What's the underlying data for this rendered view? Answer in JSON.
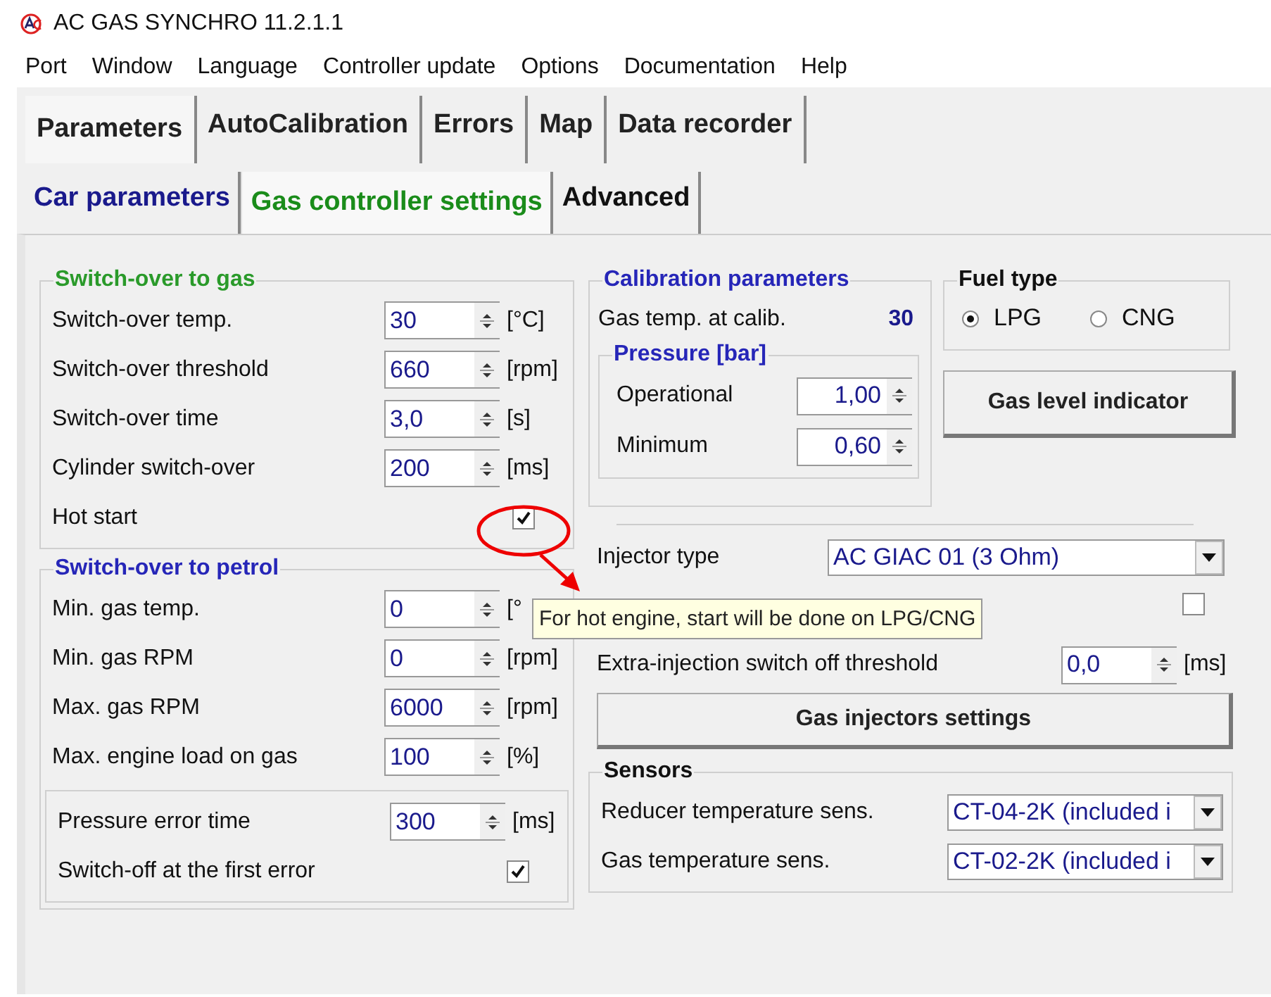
{
  "window": {
    "title": "AC GAS SYNCHRO  11.2.1.1"
  },
  "menu": [
    "Port",
    "Window",
    "Language",
    "Controller update",
    "Options",
    "Documentation",
    "Help"
  ],
  "tabs": [
    {
      "label": "Parameters",
      "selected": true
    },
    {
      "label": "AutoCalibration",
      "selected": false
    },
    {
      "label": "Errors",
      "selected": false
    },
    {
      "label": "Map",
      "selected": false
    },
    {
      "label": "Data recorder",
      "selected": false
    }
  ],
  "subtabs": [
    {
      "label": "Car parameters",
      "selected": false,
      "color": "#1a1a8c"
    },
    {
      "label": "Gas controller settings",
      "selected": true,
      "color": "#1a8c1a"
    },
    {
      "label": "Advanced",
      "selected": false,
      "color": "#111111"
    }
  ],
  "switch_to_gas": {
    "title": "Switch-over to gas",
    "rows": [
      {
        "kind": "spin",
        "label": "Switch-over temp.",
        "value": "30",
        "unit": "[°C]"
      },
      {
        "kind": "spin",
        "label": "Switch-over threshold",
        "value": "660",
        "unit": "[rpm]"
      },
      {
        "kind": "spin",
        "label": "Switch-over time",
        "value": "3,0",
        "unit": "[s]"
      },
      {
        "kind": "spin",
        "label": "Cylinder switch-over",
        "value": "200",
        "unit": "[ms]"
      },
      {
        "kind": "check",
        "label": "Hot start",
        "checked": true
      }
    ]
  },
  "switch_to_petrol": {
    "title": "Switch-over to petrol",
    "rows": [
      {
        "kind": "spin",
        "label": "Min. gas temp.",
        "value": "0",
        "unit": "[°"
      },
      {
        "kind": "spin",
        "label": "Min. gas RPM",
        "value": "0",
        "unit": "[rpm]"
      },
      {
        "kind": "spin",
        "label": "Max. gas RPM",
        "value": "6000",
        "unit": "[rpm]"
      },
      {
        "kind": "spin",
        "label": "Max. engine load on gas",
        "value": "100",
        "unit": "[%]"
      }
    ],
    "error_rows": [
      {
        "kind": "spin",
        "label": "Pressure error time",
        "value": "300",
        "unit": "[ms]"
      },
      {
        "kind": "check",
        "label": "Switch-off at the first error",
        "checked": true
      }
    ]
  },
  "calibration": {
    "title": "Calibration parameters",
    "gas_temp_label": "Gas temp. at calib.",
    "gas_temp_value": "30",
    "pressure": {
      "title": "Pressure [bar]",
      "rows": [
        {
          "label": "Operational",
          "value": "1,00"
        },
        {
          "label": "Minimum",
          "value": "0,60"
        }
      ]
    }
  },
  "fuel_type": {
    "title": "Fuel type",
    "options": [
      {
        "label": "LPG",
        "selected": true
      },
      {
        "label": "CNG",
        "selected": false
      }
    ]
  },
  "gas_level_button": "Gas level indicator",
  "injector_type": {
    "label": "Injector type",
    "value": "AC GIAC 01 (3 Ohm)"
  },
  "hidden_checkbox": {
    "checked": false
  },
  "extra_injection": {
    "label": "Extra-injection switch off threshold",
    "value": "0,0",
    "unit": "[ms]"
  },
  "gas_injectors_button": "Gas injectors settings",
  "sensors": {
    "title": "Sensors",
    "rows": [
      {
        "label": "Reducer temperature sens.",
        "value": "CT-04-2K (included i"
      },
      {
        "label": "Gas temperature sens.",
        "value": "CT-02-2K (included i"
      }
    ]
  },
  "tooltip": {
    "text": "For hot engine, start will be done on LPG/CNG"
  }
}
